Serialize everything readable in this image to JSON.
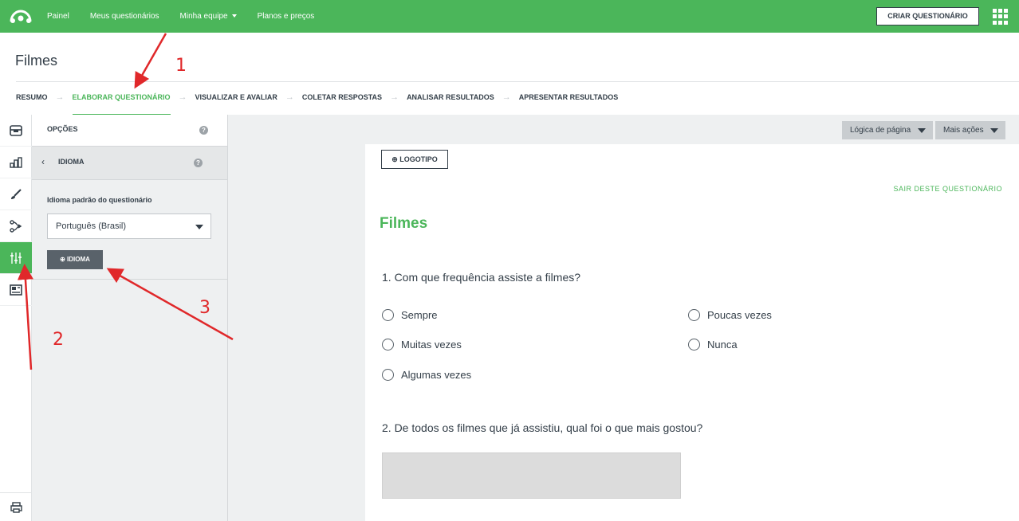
{
  "topbar": {
    "nav": [
      "Painel",
      "Meus questionários",
      "Minha equipe",
      "Planos e preços"
    ],
    "create_button": "CRIAR QUESTIONÁRIO"
  },
  "page_title": "Filmes",
  "steps": [
    "RESUMO",
    "ELABORAR QUESTIONÁRIO",
    "VISUALIZAR E AVALIAR",
    "COLETAR RESPOSTAS",
    "ANALISAR RESULTADOS",
    "APRESENTAR RESULTADOS"
  ],
  "active_step": "ELABORAR QUESTIONÁRIO",
  "rail": {
    "icons": [
      "archive-icon",
      "chart-icon",
      "brush-icon",
      "logic-icon",
      "sliders-icon",
      "layout-icon"
    ],
    "active": "sliders-icon",
    "bottom_icon": "print-icon"
  },
  "panel": {
    "header": "OPÇÕES",
    "sub_header": "IDIOMA",
    "field_label": "Idioma padrão do questionário",
    "language_value": "Português (Brasil)",
    "add_language_button": "IDIOMA",
    "help_glyph": "?"
  },
  "survey": {
    "toolbar": {
      "page_logic": "Lógica de página",
      "more_actions": "Mais ações"
    },
    "logo_button": "LOGOTIPO",
    "exit_link": "SAIR DESTE QUESTIONÁRIO",
    "title": "Filmes",
    "q1": {
      "text": "1. Com que frequência assiste a filmes?",
      "options": [
        "Sempre",
        "Muitas vezes",
        "Algumas vezes",
        "Poucas vezes",
        "Nunca"
      ]
    },
    "q2": {
      "text": "2. De todos os filmes que já assistiu, qual foi o que mais gostou?"
    }
  },
  "annotations": [
    "1",
    "2",
    "3"
  ],
  "colors": {
    "brand_green": "#4bb65a",
    "annotation_red": "#e0282a",
    "dark_text": "#333e48"
  }
}
